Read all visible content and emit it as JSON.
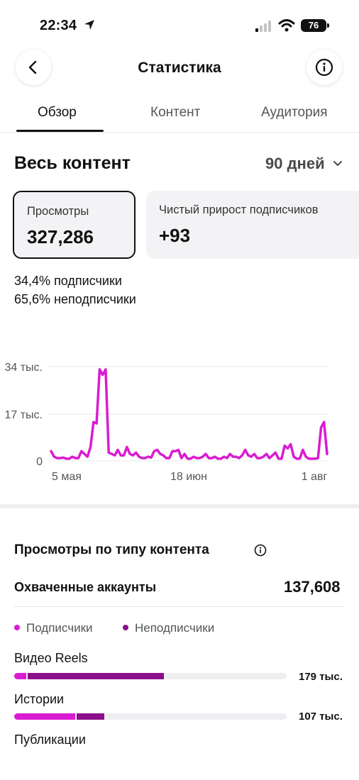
{
  "status_bar": {
    "time": "22:34",
    "battery": "76"
  },
  "header": {
    "title": "Статистика"
  },
  "tabs": [
    {
      "label": "Обзор",
      "active": true
    },
    {
      "label": "Контент",
      "active": false
    },
    {
      "label": "Аудитория",
      "active": false
    }
  ],
  "overview": {
    "title": "Весь контент",
    "range": "90 дней",
    "cards": [
      {
        "label": "Просмотры",
        "value": "327,286",
        "selected": true
      },
      {
        "label": "Чистый прирост подписчиков",
        "value": "+93",
        "selected": false
      }
    ],
    "split": [
      {
        "pct": "34,4%",
        "label": "подписчики"
      },
      {
        "pct": "65,6%",
        "label": "неподписчики"
      }
    ]
  },
  "colors": {
    "accent": "#d91cd1",
    "followers": "#d91cd1",
    "non_followers": "#8b0f8a",
    "text": "#111111"
  },
  "chart_data": {
    "type": "line",
    "x_tick_labels": [
      "5 мая",
      "18 июн",
      "1 авг"
    ],
    "y_tick_labels": [
      "0",
      "17 тыс.",
      "34 тыс."
    ],
    "ylim": [
      0,
      34000
    ],
    "grid": true,
    "series": [
      {
        "values": [
          3500,
          1500,
          1000,
          1000,
          1200,
          800,
          800,
          1500,
          1000,
          1000,
          3500,
          2500,
          1500,
          5000,
          14000,
          13500,
          33000,
          31000,
          33000,
          3000,
          2500,
          2000,
          4000,
          2000,
          2000,
          5000,
          2500,
          2000,
          3000,
          1500,
          1000,
          1000,
          1500,
          1200,
          3500,
          4000,
          2500,
          2000,
          1000,
          1000,
          3500,
          3500,
          4000,
          1000,
          2500,
          800,
          800,
          1500,
          1000,
          1000,
          1500,
          2500,
          1000,
          1000,
          1500,
          800,
          800,
          1500,
          1000,
          2500,
          1500,
          1500,
          1000,
          2000,
          4000,
          2000,
          1500,
          2500,
          1000,
          1000,
          1500,
          2500,
          1000,
          2000,
          3000,
          800,
          800,
          5500,
          4500,
          6000,
          1500,
          800,
          800,
          4000,
          1500,
          800,
          800,
          800,
          1000,
          12000,
          14000,
          2500
        ]
      }
    ]
  },
  "content_types": {
    "title": "Просмотры по типу контента",
    "reach_label": "Охваченные аккаунты",
    "reach_value": "137,608",
    "legend": [
      {
        "label": "Подписчики"
      },
      {
        "label": "Неподписчики"
      }
    ],
    "rows": [
      {
        "label": "Видео Reels",
        "value": "179 тыс.",
        "followers": 0.045,
        "non_followers": 0.505
      },
      {
        "label": "Истории",
        "value": "107 тыс.",
        "followers": 0.225,
        "non_followers": 0.105
      },
      {
        "label": "Публикации"
      }
    ]
  }
}
